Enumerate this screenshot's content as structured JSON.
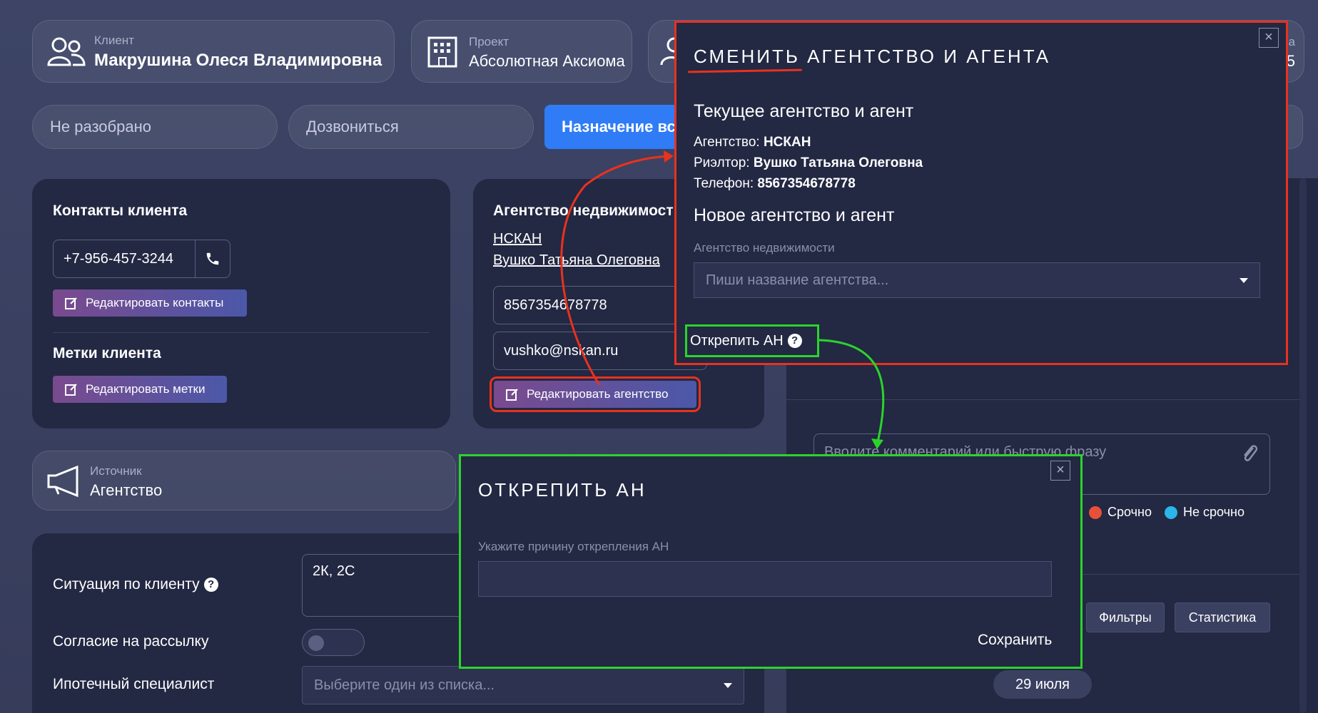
{
  "client": {
    "label": "Клиент",
    "name": "Макрушина Олеся Владимировна"
  },
  "project": {
    "label": "Проект",
    "name": "Абсолютная Аксиома"
  },
  "header_partial": {
    "a": "а",
    "b": "5"
  },
  "statuses": {
    "s1": "Не разобрано",
    "s2": "Дозвониться",
    "s3": "Назначение встр"
  },
  "contacts": {
    "title": "Контакты клиента",
    "phone": "+7-956-457-3244",
    "edit_label": "Редактировать контакты",
    "tags_title": "Метки клиента",
    "edit_tags_label": "Редактировать метки"
  },
  "agency_card": {
    "title": "Агентство недвижимости",
    "agency": "НСКАН",
    "realtor": "Вушко Татьяна Олеговна",
    "phone": "8567354678778",
    "email": "vushko@nskan.ru",
    "edit_label": "Редактировать агентство"
  },
  "source": {
    "label": "Источник",
    "value": "Агентство"
  },
  "situation": {
    "label": "Ситуация по клиенту",
    "value": "2К, 2С",
    "consent_label": "Согласие на рассылку",
    "mortgage_label": "Ипотечный специалист",
    "mortgage_placeholder": "Выберите один из списка..."
  },
  "comment": {
    "placeholder": "Вводите комментарий или быструю фразу"
  },
  "priority": {
    "urgent": "Срочно",
    "not_urgent": "Не срочно",
    "urgent_color": "#e8503a",
    "not_urgent_color": "#2bb5e8"
  },
  "toolbar": {
    "filters": "Фильтры",
    "stats": "Статистика"
  },
  "date_chip": "29 июля",
  "modal_change": {
    "title": "СМЕНИТЬ АГЕНТСТВО И АГЕНТА",
    "close": "×",
    "current_heading": "Текущее агентство и агент",
    "agency_label": "Агентство:",
    "agency_value": "НСКАН",
    "realtor_label": "Риэлтор:",
    "realtor_value": "Вушко Татьяна Олеговна",
    "phone_label": "Телефон:",
    "phone_value": "8567354678778",
    "new_heading": "Новое агентство и агент",
    "field_label": "Агентство недвижимости",
    "field_placeholder": "Пиши название агентства...",
    "unpin_label": "Открепить АН",
    "unpin_help": "?"
  },
  "modal_unpin": {
    "title": "ОТКРЕПИТЬ АН",
    "close": "×",
    "reason_label": "Укажите причину открепления АН",
    "reason_value": "",
    "save_label": "Сохранить"
  },
  "colors": {
    "highlight_red": "#e8321e",
    "highlight_green": "#2bd42b",
    "accent_blue": "#2f7cf6"
  }
}
